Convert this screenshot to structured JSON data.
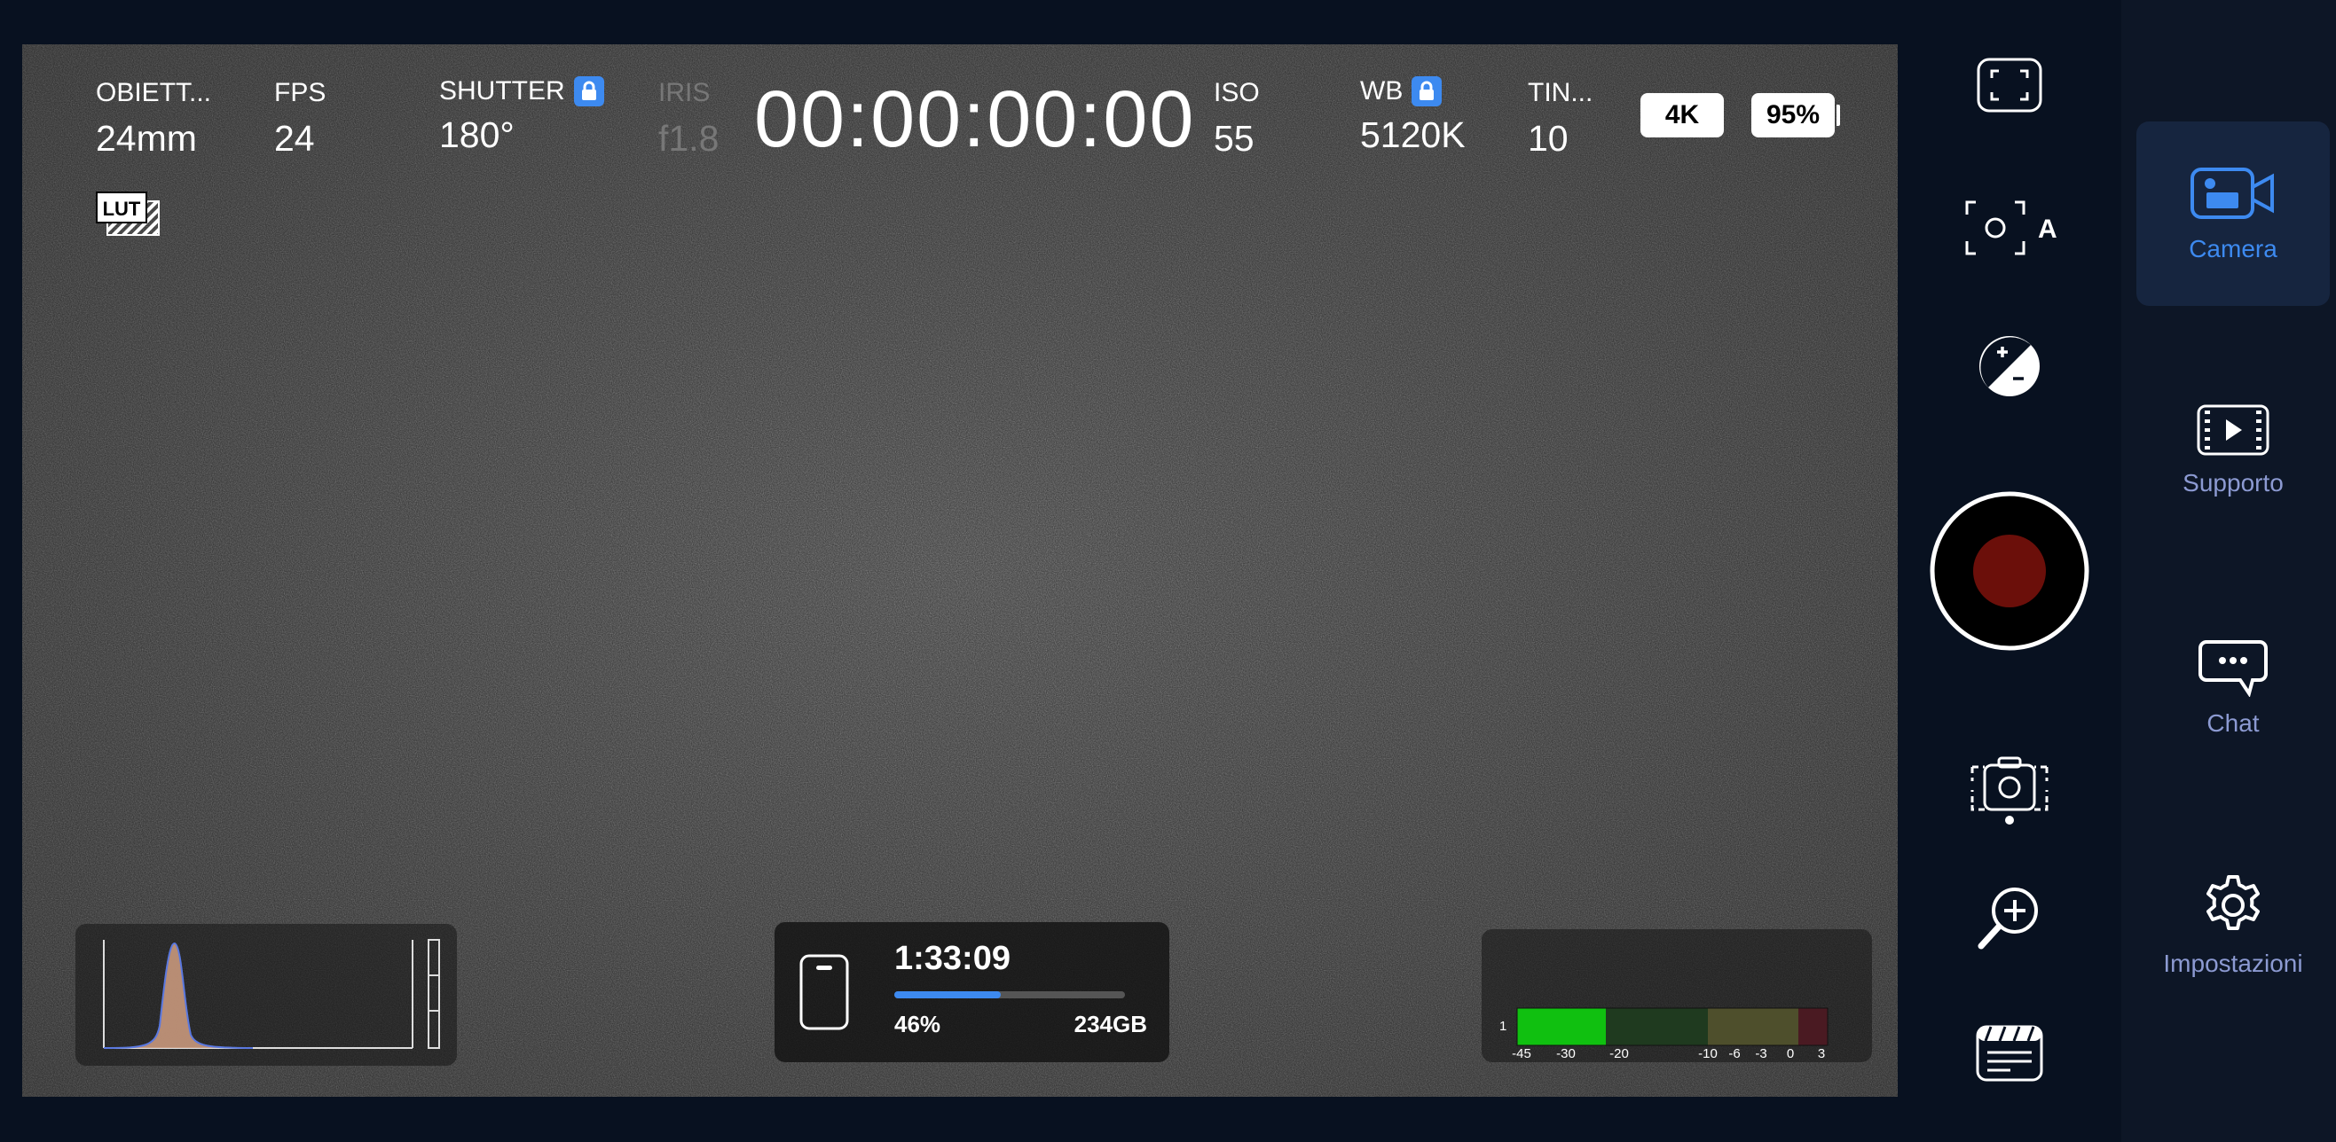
{
  "params": {
    "lens": {
      "label": "OBIETT...",
      "value": "24mm"
    },
    "fps": {
      "label": "FPS",
      "value": "24"
    },
    "shutter": {
      "label": "SHUTTER",
      "value": "180°"
    },
    "iris": {
      "label": "IRIS",
      "value": "f1.8"
    },
    "iso": {
      "label": "ISO",
      "value": "55"
    },
    "wb": {
      "label": "WB",
      "value": "5120K"
    },
    "tint": {
      "label": "TIN...",
      "value": "10"
    }
  },
  "timecode": "00:00:00:00",
  "badges": {
    "resolution": "4K",
    "battery": "95%"
  },
  "lut_label": "LUT",
  "storage": {
    "remaining_time": "1:33:09",
    "percent_label": "46%",
    "percent_fill": 0.46,
    "capacity": "234GB"
  },
  "audio": {
    "channel": "1",
    "scale": [
      "-45",
      "-30",
      "-20",
      "-10",
      "-6",
      "-3",
      "0",
      "3"
    ],
    "level_db": -28
  },
  "controls": [
    "fullscreen-toggle",
    "auto-focus",
    "exposure-compensation",
    "record",
    "camera-flip",
    "zoom",
    "clapperboard"
  ],
  "nav": [
    {
      "label": "Camera",
      "icon": "video-camera-icon",
      "active": true
    },
    {
      "label": "Supporto",
      "icon": "media-play-icon",
      "active": false
    },
    {
      "label": "Chat",
      "icon": "chat-bubble-icon",
      "active": false
    },
    {
      "label": "Impostazioni",
      "icon": "gear-icon",
      "active": false
    }
  ],
  "colors": {
    "accent": "#3d8af0",
    "record": "#6b0f0a",
    "background": "#081120",
    "audio_green": "#10c010"
  }
}
